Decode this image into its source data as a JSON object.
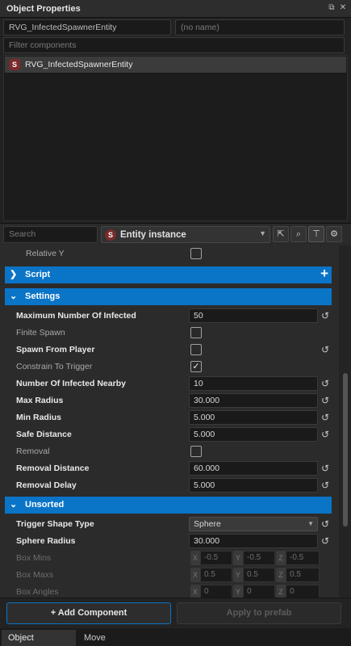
{
  "window": {
    "title": "Object Properties"
  },
  "entity": {
    "name": "RVG_InfectedSpawnerEntity",
    "alt_name_placeholder": "(no name)",
    "filter_placeholder": "Filter components",
    "list_item": "RVG_InfectedSpawnerEntity",
    "icon_glyph": "S"
  },
  "inspector": {
    "search_placeholder": "Search",
    "entity_type": "Entity instance"
  },
  "top_row": {
    "label": "Relative Y"
  },
  "sections": {
    "script": "Script",
    "settings": "Settings",
    "unsorted": "Unsorted"
  },
  "settings": [
    {
      "label": "Maximum Number Of Infected",
      "value": "50"
    },
    {
      "label": "Finite Spawn"
    },
    {
      "label": "Spawn From Player"
    },
    {
      "label": "Constrain To Trigger",
      "check": "✓"
    },
    {
      "label": "Number Of Infected Nearby",
      "value": "10"
    },
    {
      "label": "Max Radius",
      "value": "30.000"
    },
    {
      "label": "Min Radius",
      "value": "5.000"
    },
    {
      "label": "Safe Distance",
      "value": "5.000"
    },
    {
      "label": "Removal"
    },
    {
      "label": "Removal Distance",
      "value": "60.000"
    },
    {
      "label": "Removal Delay",
      "value": "5.000"
    }
  ],
  "unsorted": {
    "trigger_shape": {
      "label": "Trigger Shape Type",
      "value": "Sphere"
    },
    "sphere_radius": {
      "label": "Sphere Radius",
      "value": "30.000"
    },
    "box_mins": {
      "label": "Box Mins",
      "x": "-0.5",
      "y": "-0.5",
      "z": "-0.5"
    },
    "box_maxs": {
      "label": "Box Maxs",
      "x": "0.5",
      "y": "0.5",
      "z": "0.5"
    },
    "box_angles": {
      "label": "Box Angles",
      "x": "0",
      "y": "0",
      "z": "0"
    }
  },
  "axis_labels": {
    "x": "X",
    "y": "Y",
    "z": "Z"
  },
  "footer": {
    "add_component": "+ Add Component",
    "apply_prefab": "Apply to prefab"
  },
  "tabs": [
    "Object Properties",
    "Move"
  ],
  "colors": {
    "accent": "#0a74c7",
    "entity_icon": "#7a2b2b"
  }
}
